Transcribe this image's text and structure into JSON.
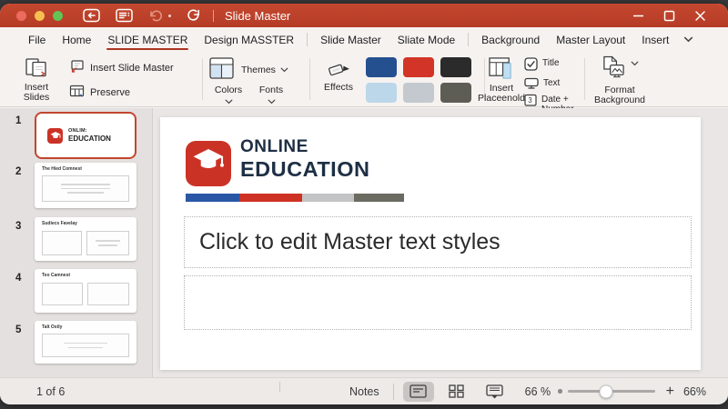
{
  "titlebar": {
    "title": "Slide Master"
  },
  "tabs": {
    "items": [
      {
        "label": "File"
      },
      {
        "label": "Home"
      },
      {
        "label": "SLIDE MASTER"
      },
      {
        "label": "Design MASSTER"
      },
      {
        "label": "Slide Master"
      },
      {
        "label": "Sliate Mode"
      },
      {
        "label": "Background"
      },
      {
        "label": "Master Layout"
      },
      {
        "label": "Insert"
      }
    ],
    "active": "SLIDE MASTER"
  },
  "ribbon": {
    "insert_slides": "Insert Slides",
    "insert_slide_master": "Insert Slide Master",
    "preserve": "Preserve",
    "themes": "Themes",
    "colors": "Colors",
    "fonts": "Fonts",
    "effects": "Effects",
    "insert_placeholder": "Insert Placeenold",
    "title_checkbox": "Title",
    "text_checkbox": "Text",
    "date_checkbox": "Date + Number",
    "format_background": "Format Background",
    "swatches": [
      "#24508F",
      "#D23527",
      "#2B2B2B",
      "#BCD7E9",
      "#C3C9CF",
      "#5D5D55"
    ]
  },
  "thumbnails": {
    "items": [
      {
        "number": "1",
        "logo_top": "ONLIM:",
        "logo_bottom": "EDUCATION"
      },
      {
        "number": "2",
        "caption": "The Hied Comnest"
      },
      {
        "number": "3",
        "caption": "Sudiecs Favelay"
      },
      {
        "number": "4",
        "caption": "Teo Camnest"
      },
      {
        "number": "5",
        "caption": "Talt Ostly"
      }
    ]
  },
  "slide": {
    "logo_line1": "ONLINE",
    "logo_line2": "EDUCATION",
    "bar_colors": [
      "#2A57A5",
      "#CE3224",
      "#C3C4C6",
      "#6B6B62"
    ],
    "title_placeholder": "Click to edit Master text styles"
  },
  "statusbar": {
    "page": "1 of 6",
    "notes": "Notes",
    "zoom_value": "66 %",
    "zoom_plus": "+",
    "zoom_percent": "66%"
  }
}
